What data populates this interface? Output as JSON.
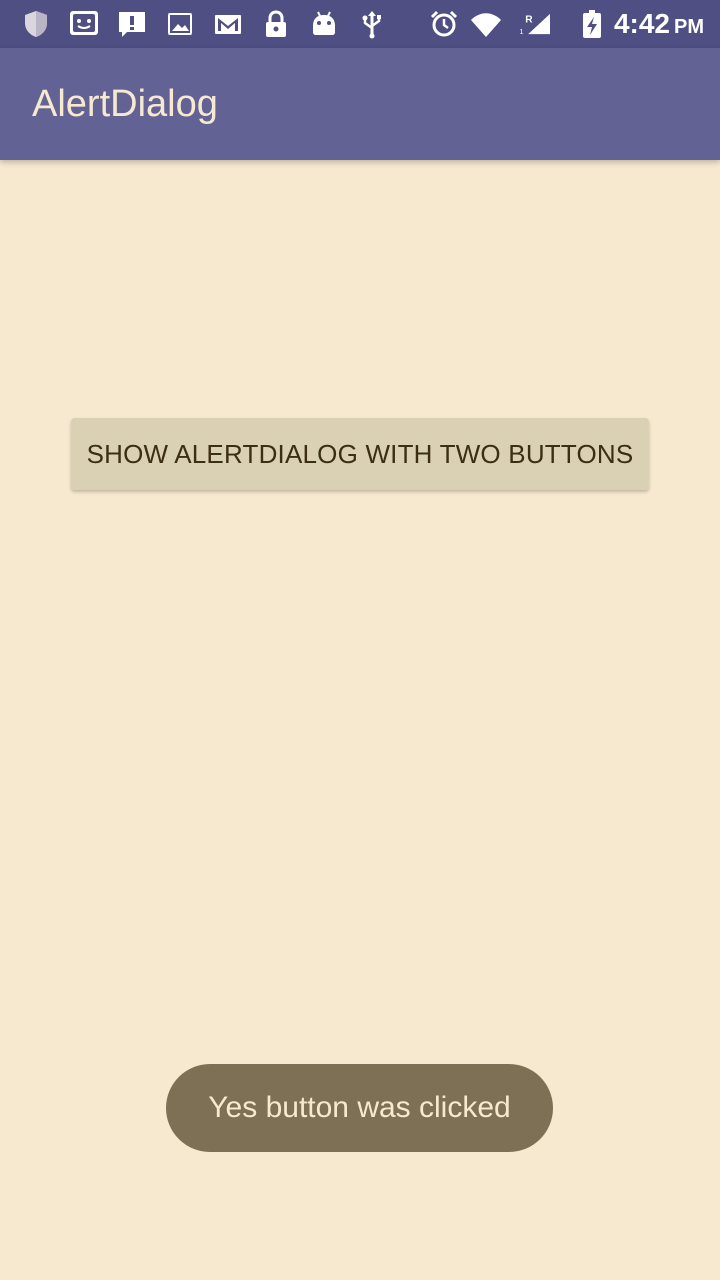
{
  "status_bar": {
    "time": "4:42",
    "ampm": "PM",
    "network_roaming": "R",
    "sim_slot": "1",
    "icons": [
      "shield-icon",
      "face-notification-icon",
      "alert-message-icon",
      "image-icon",
      "gmail-icon",
      "lock-icon",
      "android-icon",
      "usb-icon",
      "alarm-icon",
      "wifi-icon",
      "signal-icon",
      "battery-charging-icon"
    ]
  },
  "app_bar": {
    "title": "AlertDialog"
  },
  "main": {
    "button_label": "SHOW ALERTDIALOG WITH TWO BUTTONS"
  },
  "toast": {
    "message": "Yes button was clicked"
  },
  "colors": {
    "status_bar": "#4f4f84",
    "app_bar": "#636294",
    "background": "#f7e9cf",
    "button": "#dad0b3",
    "button_text": "#3c2e14",
    "toast": "#7e7055",
    "toast_text": "#f7e9cf"
  }
}
